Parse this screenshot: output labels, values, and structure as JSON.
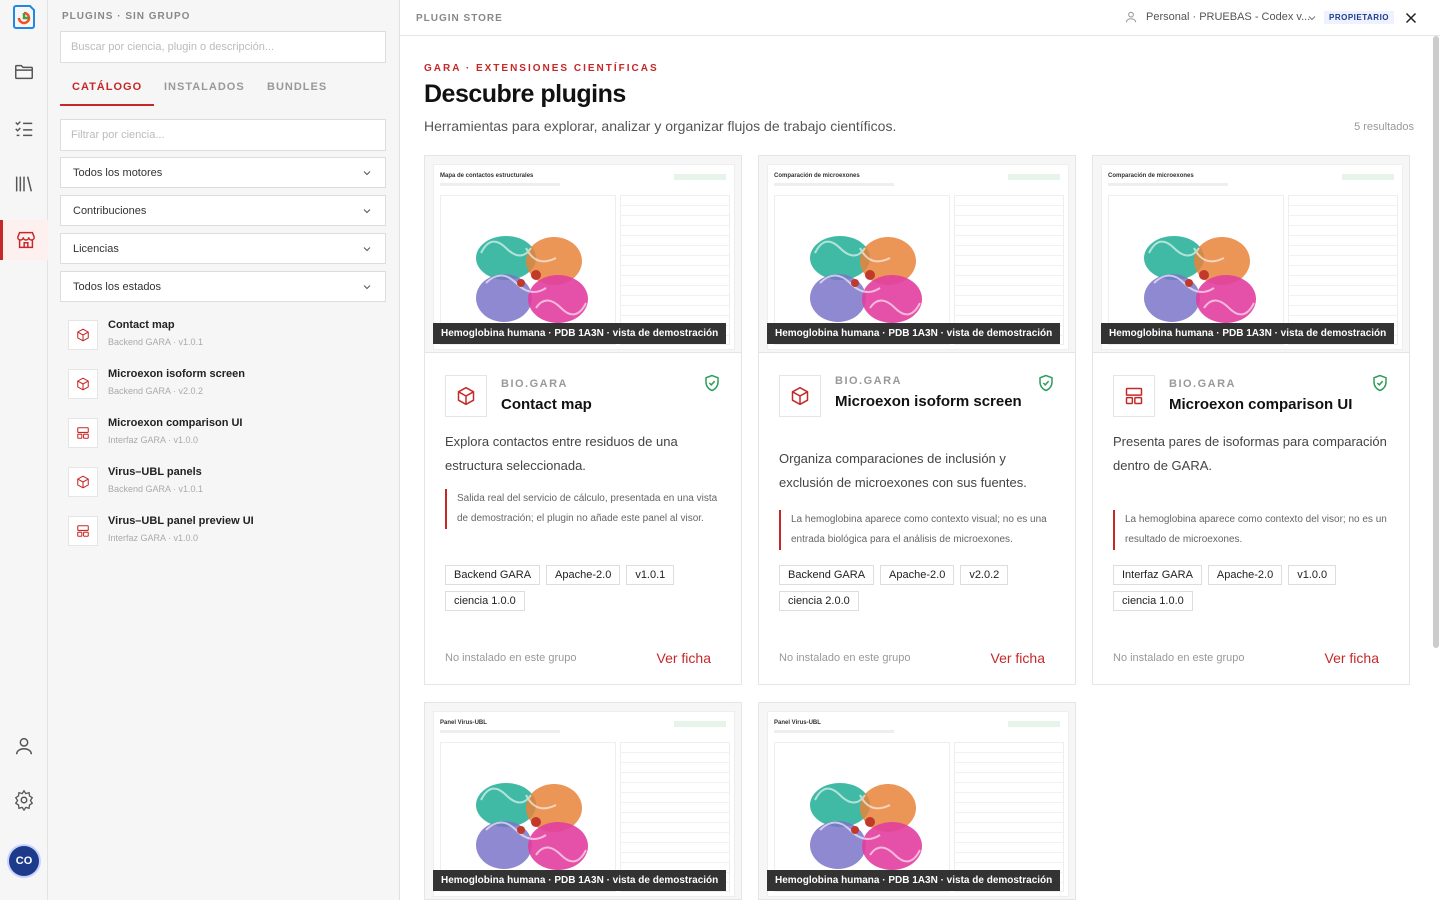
{
  "rail": {
    "avatar_initials": "CO"
  },
  "sidebar": {
    "header": "PLUGINS · SIN GRUPO",
    "search_placeholder": "Buscar por ciencia, plugin o descripción...",
    "tabs": [
      {
        "label": "CATÁLOGO",
        "active": true
      },
      {
        "label": "INSTALADOS",
        "active": false
      },
      {
        "label": "BUNDLES",
        "active": false
      }
    ],
    "filter_placeholder": "Filtrar por ciencia...",
    "selects": [
      "Todos los motores",
      "Contribuciones",
      "Licencias",
      "Todos los estados"
    ],
    "plugins": [
      {
        "name": "Contact map",
        "meta": "Backend GARA · v1.0.1",
        "icon": "cube-icon"
      },
      {
        "name": "Microexon isoform screen",
        "meta": "Backend GARA · v2.0.2",
        "icon": "cube-icon"
      },
      {
        "name": "Microexon comparison UI",
        "meta": "Interfaz GARA · v1.0.0",
        "icon": "layout-icon"
      },
      {
        "name": "Virus–UBL panels",
        "meta": "Backend GARA · v1.0.1",
        "icon": "cube-icon"
      },
      {
        "name": "Virus–UBL panel preview UI",
        "meta": "Interfaz GARA · v1.0.0",
        "icon": "layout-icon"
      }
    ]
  },
  "topbar": {
    "title": "PLUGIN STORE",
    "user": "Personal · PRUEBAS - Codex v...",
    "role": "PROPIETARIO"
  },
  "main": {
    "eyebrow": "GARA · EXTENSIONES CIENTÍFICAS",
    "heading": "Descubre plugins",
    "subtitle": "Herramientas para explorar, analizar y organizar flujos de trabajo científicos.",
    "results": "5 resultados"
  },
  "cards": [
    {
      "preview_title": "Mapa de contactos estructurales",
      "caption": "Hemoglobina humana · PDB 1A3N · vista de demostración",
      "publisher": "BIO.GARA",
      "name": "Contact map",
      "icon": "cube-icon",
      "description": "Explora contactos entre residuos de una estructura seleccionada.",
      "note": "Salida real del servicio de cálculo, presentada en una vista de demostración; el plugin no añade este panel al visor.",
      "tags": [
        "Backend GARA",
        "Apache-2.0",
        "v1.0.1",
        "ciencia 1.0.0"
      ],
      "status": "No instalado en este grupo",
      "link": "Ver ficha"
    },
    {
      "preview_title": "Comparación de microexones",
      "caption": "Hemoglobina humana · PDB 1A3N · vista de demostración",
      "publisher": "BIO.GARA",
      "name": "Microexon isoform screen",
      "icon": "cube-icon",
      "description": "Organiza comparaciones de inclusión y exclusión de microexones con sus fuentes.",
      "note": "La hemoglobina aparece como contexto visual; no es una entrada biológica para el análisis de microexones.",
      "tags": [
        "Backend GARA",
        "Apache-2.0",
        "v2.0.2",
        "ciencia 2.0.0"
      ],
      "status": "No instalado en este grupo",
      "link": "Ver ficha"
    },
    {
      "preview_title": "Comparación de microexones",
      "caption": "Hemoglobina humana · PDB 1A3N · vista de demostración",
      "publisher": "BIO.GARA",
      "name": "Microexon comparison UI",
      "icon": "layout-icon",
      "description": "Presenta pares de isoformas para comparación dentro de GARA.",
      "note": "La hemoglobina aparece como contexto del visor; no es un resultado de microexones.",
      "tags": [
        "Interfaz GARA",
        "Apache-2.0",
        "v1.0.0",
        "ciencia 1.0.0"
      ],
      "status": "No instalado en este grupo",
      "link": "Ver ficha"
    },
    {
      "preview_title": "Panel Virus-UBL",
      "caption": "Hemoglobina humana · PDB 1A3N · vista de demostración"
    },
    {
      "preview_title": "Panel Virus-UBL",
      "caption": "Hemoglobina humana · PDB 1A3N · vista de demostración"
    }
  ]
}
